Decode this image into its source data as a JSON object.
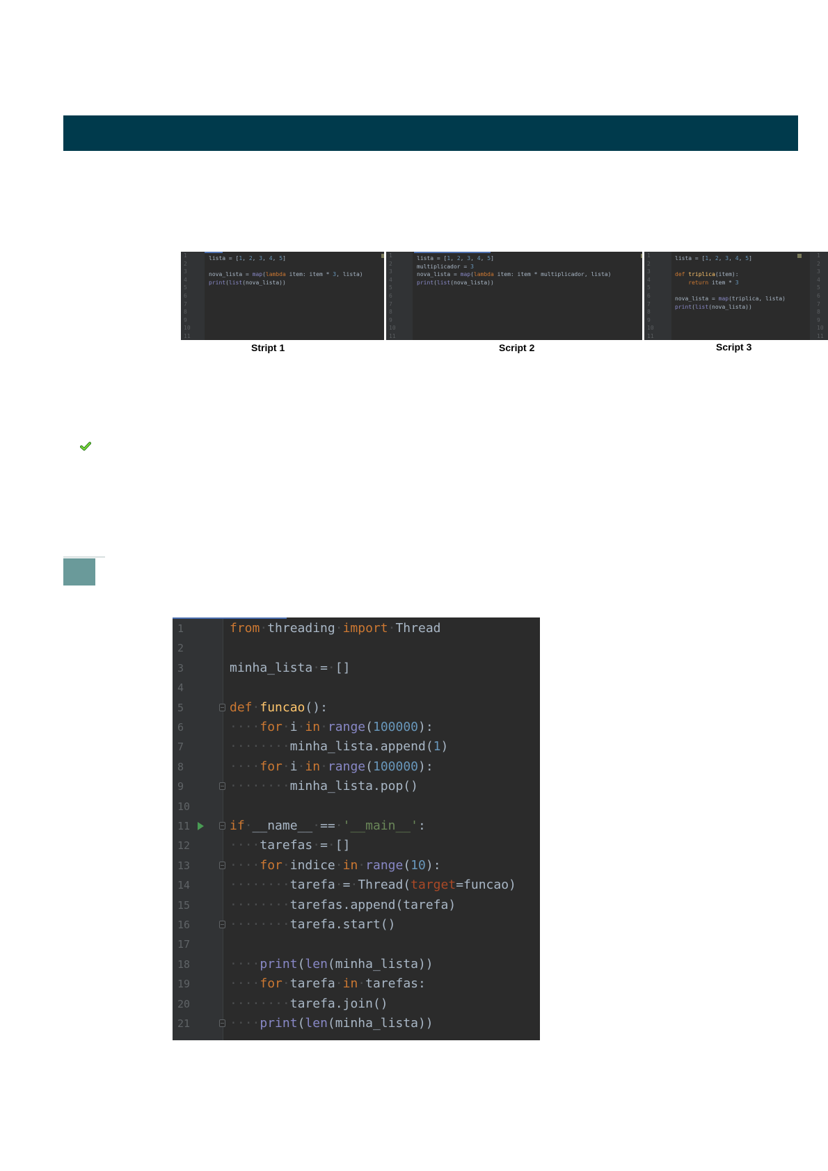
{
  "header": {
    "color": "#003a4c"
  },
  "scripts": [
    {
      "caption": "Stript 1",
      "line_numbers": [
        "1",
        "2",
        "3",
        "4",
        "5",
        "6",
        "7",
        "8",
        "9",
        "10",
        "11"
      ],
      "lines": [
        "lista = [1, 2, 3, 4, 5]",
        "",
        "nova_lista = map(lambda item: item * 3, lista)",
        "print(list(nova_lista))"
      ]
    },
    {
      "caption": "Script 2",
      "line_numbers": [
        "1",
        "2",
        "3",
        "4",
        "5",
        "6",
        "7",
        "8",
        "9",
        "10",
        "11"
      ],
      "lines": [
        "lista = [1, 2, 3, 4, 5]",
        "multiplicador = 3",
        "nova_lista = map(lambda item: item * multiplicador, lista)",
        "print(list(nova_lista))"
      ]
    },
    {
      "caption": "Script 3",
      "line_numbers": [
        "1",
        "2",
        "3",
        "4",
        "5",
        "6",
        "7",
        "8",
        "9",
        "10",
        "11"
      ],
      "lines": [
        "lista = [1, 2, 3, 4, 5]",
        "",
        "def triplica(item):",
        "    return item * 3",
        "",
        "nova_lista = map(triplica, lista)",
        "print(list(nova_lista))"
      ]
    }
  ],
  "check_icon": "checkmark-icon",
  "code_editor": {
    "line_numbers": [
      "1",
      "2",
      "3",
      "4",
      "5",
      "6",
      "7",
      "8",
      "9",
      "10",
      "11",
      "12",
      "13",
      "14",
      "15",
      "16",
      "17",
      "18",
      "19",
      "20",
      "21"
    ],
    "lines": [
      "from threading import Thread",
      "",
      "minha_lista = []",
      "",
      "def funcao():",
      "    for i in range(100000):",
      "        minha_lista.append(1)",
      "    for i in range(100000):",
      "        minha_lista.pop()",
      "",
      "if __name__ == '__main__':",
      "    tarefas = []",
      "    for indice in range(10):",
      "        tarefa = Thread(target=funcao)",
      "        tarefas.append(tarefa)",
      "        tarefa.start()",
      "",
      "    print(len(minha_lista))",
      "    for tarefa in tarefas:",
      "        tarefa.join()",
      "    print(len(minha_lista))"
    ],
    "colors": {
      "background": "#2b2b2b",
      "keyword": "#cc7832",
      "number": "#6897bb",
      "builtin": "#8888c6",
      "function": "#ffc66d",
      "string": "#6a8759",
      "parameter": "#aa4926",
      "text": "#a9b7c6"
    }
  }
}
